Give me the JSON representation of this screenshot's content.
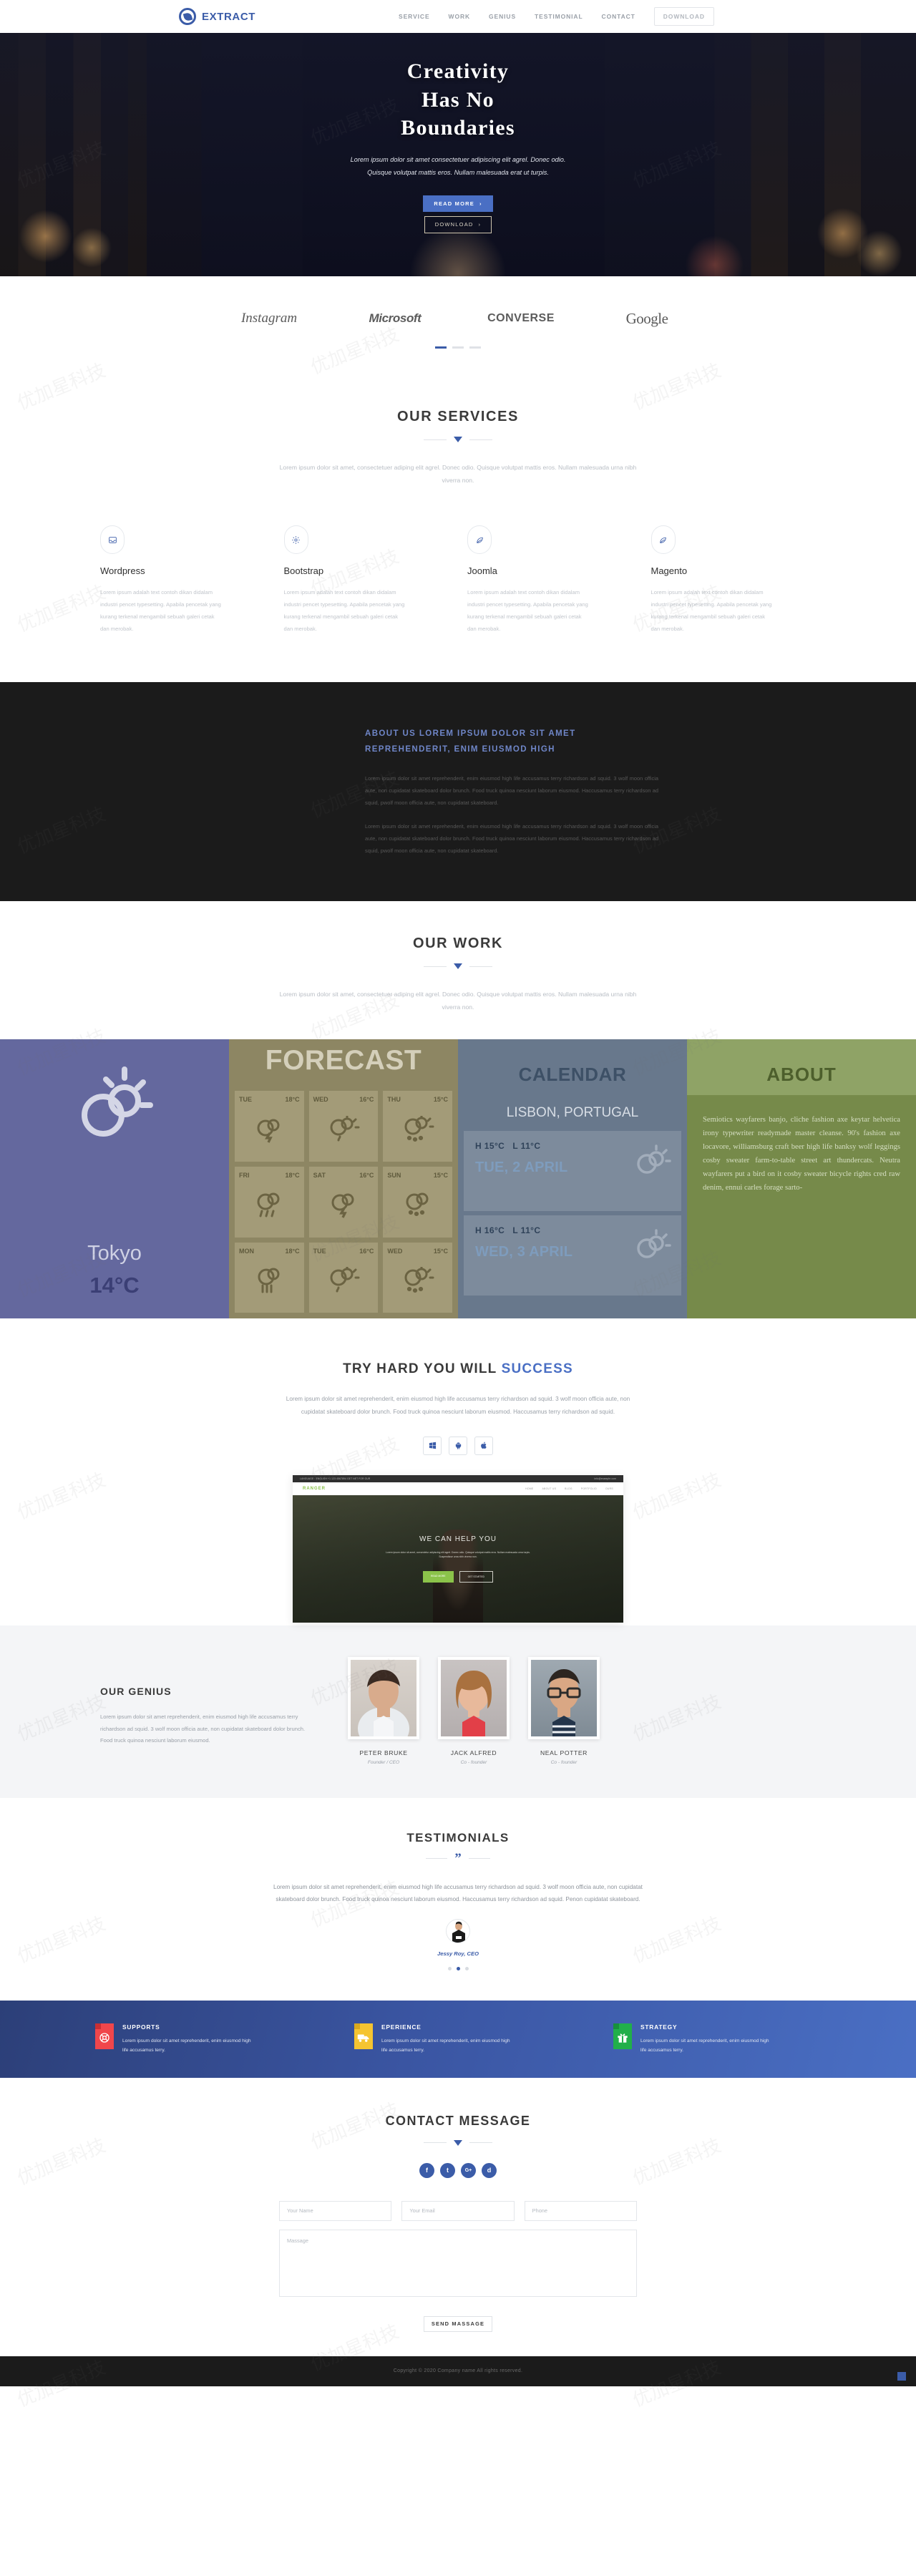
{
  "header": {
    "brand": "EXTRACT",
    "brand_icon": "leaf-circle-icon",
    "nav": [
      {
        "label": "SERVICE"
      },
      {
        "label": "WORK"
      },
      {
        "label": "GENIUS"
      },
      {
        "label": "TESTIMONIAL"
      },
      {
        "label": "CONTACT"
      }
    ],
    "download_label": "DOWNLOAD"
  },
  "hero": {
    "title_line1": "Creativity",
    "title_line2": "Has  No",
    "title_line3": "Boundaries",
    "paragraph": "Lorem ipsum dolor sit amet consectetuer adipiscing elit agrel. Donec odio. Quisque volutpat mattis eros. Nullam malesuada erat ut turpis.",
    "read_more": "READ MORE",
    "download": "DOWNLOAD"
  },
  "clients": {
    "logos": [
      "Instagram",
      "Microsoft",
      "CONVERSE",
      "Google"
    ],
    "slider_dots": 3,
    "active_dot": 0
  },
  "services": {
    "title": "OUR SERVICES",
    "subtitle": "Lorem ipsum dolor sit amet, consectetuer adiping elit agrel. Donec odio. Quisque volutpat mattis eros. Nullam malesuada urna nibh viverra non.",
    "items": [
      {
        "icon": "inbox-icon",
        "title": "Wordpress",
        "text": "Lorem ipsum adalah text contoh dikan didalam industri pencet typesetting. Apabila pencetak yang kurang terkenal mengambil sebuah galeri cetak dan merobak."
      },
      {
        "icon": "gear-icon",
        "title": "Bootstrap",
        "text": "Lorem ipsum adalah text contoh dikan didalam industri pencet typesetting. Apabila pencetak yang kurang terkenal mengambil sebuah galeri cetak dan merobak."
      },
      {
        "icon": "leaf-icon",
        "title": "Joomla",
        "text": "Lorem ipsum adalah text contoh dikan didalam industri pencet typesetting. Apabila pencetak yang kurang terkenal mengambil sebuah galeri cetak dan merobak."
      },
      {
        "icon": "leaf-icon",
        "title": "Magento",
        "text": "Lorem ipsum adalah text contoh dikan didalam industri pencet typesetting. Apabila pencetak yang kurang terkenal mengambil sebuah galeri cetak dan merobak."
      }
    ]
  },
  "about": {
    "heading": "ABOUT US LOREM IPSUM DOLOR SIT AMET REPREHENDERIT, ENIM EIUSMOD HIGH",
    "p1": "Lorem ipsum dolor sit amet reprehenderit, enim eiusmod high life accusamus terry richardson ad squid. 3 wolf moon officia aute, non cupidatat skateboard dolor brunch. Food truck quinoa nesciunt laborum eiusmod. Haccusamus terry richardson ad squid, pwolf moon officia aute, non cupidatat skateboard.",
    "p2": "Lorem ipsum dolor sit amet reprehenderit, enim eiusmod high life accusamus terry richardson ad squid. 3 wolf moon officia aute, non cupidatat skateboard dolor brunch. Food truck quinoa nesciunt laborum eiusmod. Haccusamus terry richardson ad squid, pwolf moon officia aute, non cupidatat skateboard."
  },
  "work": {
    "title": "OUR WORK",
    "subtitle": "Lorem ipsum dolor sit amet, consectetuer adiping elit agrel. Donec odio. Quisque volutpat mattis eros. Nullam malesuada urna nibh viverra non.",
    "weather_tile": {
      "icon": "sun-cloud-icon",
      "city": "Tokyo",
      "temperature": "14°C"
    },
    "forecast_tile": {
      "title": "FORECAST",
      "days": [
        {
          "day": "TUE",
          "temp": "18°C",
          "icon": "storm-icon"
        },
        {
          "day": "WED",
          "temp": "16°C",
          "icon": "sun-rain-icon"
        },
        {
          "day": "THU",
          "temp": "15°C",
          "icon": "sun-snow-icon"
        },
        {
          "day": "FRI",
          "temp": "18°C",
          "icon": "rain-icon"
        },
        {
          "day": "SAT",
          "temp": "16°C",
          "icon": "storm-icon"
        },
        {
          "day": "SUN",
          "temp": "15°C",
          "icon": "snow-icon"
        },
        {
          "day": "MON",
          "temp": "18°C",
          "icon": "heavy-rain-icon"
        },
        {
          "day": "TUE",
          "temp": "16°C",
          "icon": "sun-rain-icon"
        },
        {
          "day": "WED",
          "temp": "15°C",
          "icon": "sun-snow-icon"
        }
      ]
    },
    "calendar_tile": {
      "title": "CALENDAR",
      "location": "LISBON, PORTUGAL",
      "entries": [
        {
          "high": "H 15°C",
          "low": "L 11°C",
          "date": "TUE, 2 APRIL"
        },
        {
          "high": "H 16°C",
          "low": "L 11°C",
          "date": "WED, 3 APRIL"
        }
      ]
    },
    "about_tile": {
      "title": "ABOUT",
      "text": "Semiotics wayfarers banjo, cliche fashion axe keytar helvetica irony typewriter readymade master cleanse. 90's fashion axe locavore, williamsburg craft beer high life banksy wolf leggings cosby sweater farm-to-table street art thundercats. Neutra wayfarers put a bird on it cosby sweater bicycle rights cred raw denim, ennui carles forage sarto-"
    }
  },
  "success": {
    "title_plain": "TRY HARD YOU WILL ",
    "title_highlight": "SUCCESS",
    "paragraph": "Lorem ipsum dolor sit amet reprehenderit, enim eiusmod high life accusamus terry richardson ad squid. 3 wolf moon officia aute, non cupidatat skateboard dolor brunch. Food truck quinoa nesciunt laborum eiusmod. Haccusamus terry richardson ad squid.",
    "os_buttons": [
      "windows-icon",
      "android-icon",
      "apple-icon"
    ],
    "mockup": {
      "topbar_left": "LANGUAGE : ENGLISH   +1 123 4567894   GET  NET  FOR  OUR",
      "topbar_right": "info@example.com",
      "logo": "RANGER",
      "links": [
        "HOME",
        "ABOUT US",
        "BLOG",
        "PORTFOLIO",
        "OURS"
      ],
      "hero_title": "WE CAN HELP YOU",
      "hero_text": "Lorem ipsum dolor sit amet, consectetur adipiscing elit agrel. Donec odio. Quisque volutpat mattis eros. Nullam malesuada urna turpis. Suspendisse urna nibh viverra non.",
      "btn_primary": "READ MORE",
      "btn_secondary": "GET STARTED"
    }
  },
  "genius": {
    "title": "OUR GENIUS",
    "paragraph": "Lorem ipsum dolor sit amet reprehenderit, enim eiusmod high life accusamus terry richardson ad squid. 3 wolf moon officia aute, non cupidatat skateboard dolor brunch. Food truck quinoa nesciunt laborum eiusmod.",
    "members": [
      {
        "name": "PETER BRUKE",
        "role": "Founder / CEO"
      },
      {
        "name": "JACK ALFRED",
        "role": "Co - founder"
      },
      {
        "name": "NEAL POTTER",
        "role": "Co - founder"
      }
    ]
  },
  "testimonials": {
    "title": "TESTIMONIALS",
    "quote_icon": "quote-icon",
    "body": "Lorem ipsum dolor sit amet reprehenderit, enim eiusmod high life accusamus terry richardson ad squid. 3 wolf moon officia aute, non cupidatat skateboard dolor brunch. Food truck quinoa nesciunt laborum eiusmod. Haccusamus terry richardson ad squid. Penon cupidatat skateboard.",
    "author": "Jessy Roy, CEO",
    "dots": 3,
    "active_dot": 1
  },
  "features": [
    {
      "icon": "lifebuoy-icon",
      "color": "#f0464b",
      "title": "SUPPORTS",
      "text": "Lorem ipsum dolor sit amet reprehenderit, enim eiusmod high life accusamus terry."
    },
    {
      "icon": "truck-icon",
      "color": "#f5c431",
      "title": "EPERIENCE",
      "text": "Lorem ipsum dolor sit amet reprehenderit, enim eiusmod high life accusamus terry."
    },
    {
      "icon": "gift-icon",
      "color": "#21af4a",
      "title": "STRATEGY",
      "text": "Lorem ipsum dolor sit amet reprehenderit, enim eiusmod high life accusamus terry."
    }
  ],
  "contact": {
    "title": "CONTACT MESSAGE",
    "socials": [
      {
        "icon": "facebook-icon",
        "glyph": "f"
      },
      {
        "icon": "twitter-icon",
        "glyph": "t"
      },
      {
        "icon": "google-plus-icon",
        "glyph": "G+"
      },
      {
        "icon": "dribbble-icon",
        "glyph": "d"
      }
    ],
    "name_placeholder": "Your Name",
    "email_placeholder": "Your Email",
    "phone_placeholder": "Phone",
    "message_placeholder": "Massage",
    "submit_label": "SEND MASSAGE"
  },
  "footer": {
    "copyright": "Copyright © 2020 Company name All rights reserved.",
    "scroll_top_icon": "scroll-top-icon"
  },
  "colors": {
    "accent": "#3b5ca8",
    "hero_button": "#4a6fc4",
    "dark": "#1b1b1b"
  }
}
